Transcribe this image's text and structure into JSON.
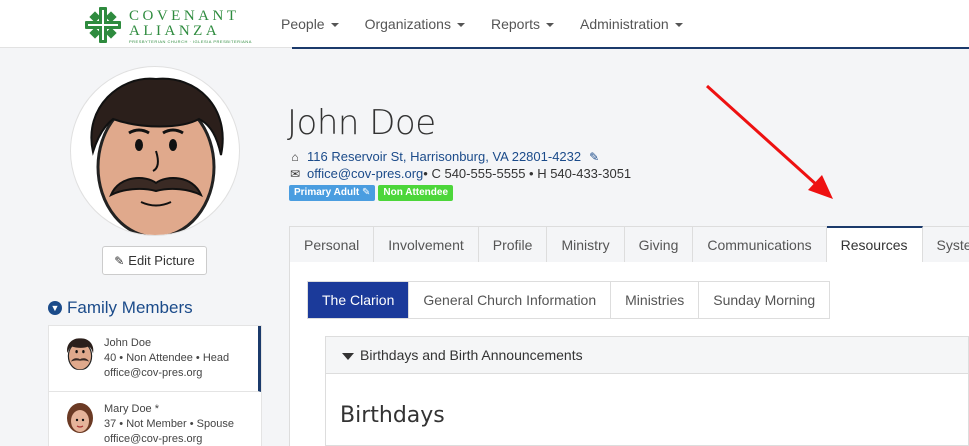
{
  "brand": {
    "line1": "COVENANT",
    "line2": "ALIANZA",
    "tagline": "PRESBYTERIAN CHURCH · IGLESIA PRESBITERIANA",
    "color": "#2e8b3e"
  },
  "nav": {
    "items": [
      {
        "label": "People"
      },
      {
        "label": "Organizations"
      },
      {
        "label": "Reports"
      },
      {
        "label": "Administration"
      }
    ]
  },
  "profile": {
    "name": "John Doe",
    "address": "116 Reservoir St, Harrisonburg, VA 22801-4232",
    "email": "office@cov-pres.org",
    "phones": " • C 540-555-5555 • H 540-433-3051",
    "edit_picture": "Edit Picture",
    "badges": [
      {
        "label": "Primary Adult",
        "color": "#4a9de0"
      },
      {
        "label": "Non Attendee",
        "color": "#4cd63a"
      }
    ]
  },
  "family": {
    "title": "Family Members",
    "members": [
      {
        "name": "John Doe",
        "detail": "40 • Non Attendee • Head",
        "email": "office@cov-pres.org"
      },
      {
        "name": "Mary Doe *",
        "detail": "37 • Not Member • Spouse",
        "email": "office@cov-pres.org"
      }
    ]
  },
  "tabs": [
    {
      "label": "Personal"
    },
    {
      "label": "Involvement"
    },
    {
      "label": "Profile"
    },
    {
      "label": "Ministry"
    },
    {
      "label": "Giving"
    },
    {
      "label": "Communications"
    },
    {
      "label": "Resources"
    },
    {
      "label": "System"
    }
  ],
  "active_tab": "Resources",
  "subtabs": [
    {
      "label": "The Clarion"
    },
    {
      "label": "General Church Information"
    },
    {
      "label": "Ministries"
    },
    {
      "label": "Sunday Morning"
    }
  ],
  "active_subtab": "The Clarion",
  "accordion": {
    "title": "Birthdays and Birth Announcements",
    "heading": "Birthdays"
  },
  "annotation": {
    "color": "#ee1111",
    "icon": "red-arrow"
  }
}
